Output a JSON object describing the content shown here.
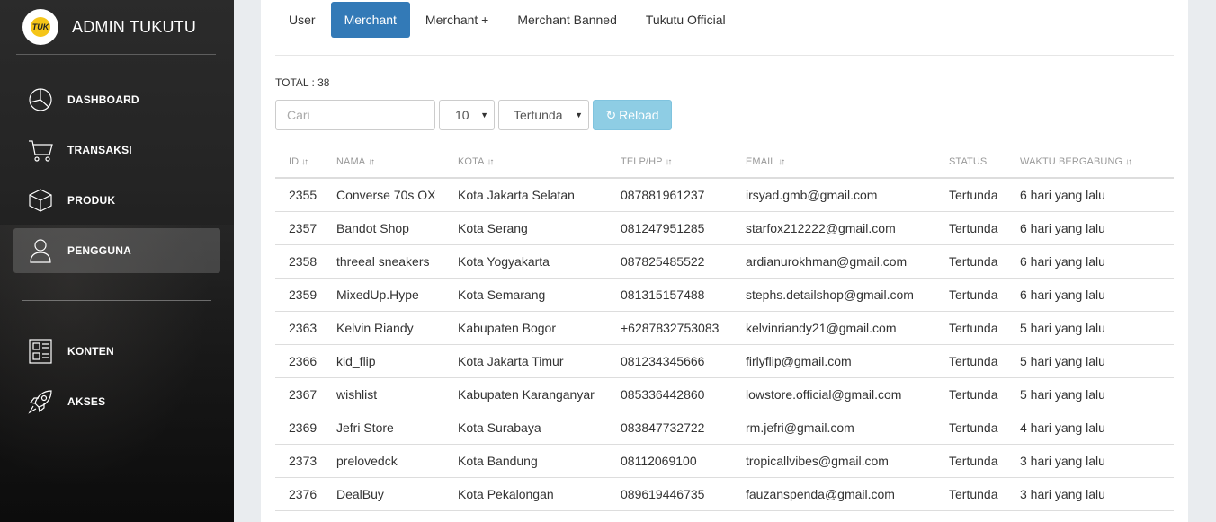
{
  "brand": {
    "logo_text": "TUK",
    "title": "ADMIN TUKUTU"
  },
  "sidebar": {
    "items": [
      {
        "label": "DASHBOARD",
        "icon": "pie-chart-icon"
      },
      {
        "label": "TRANSAKSI",
        "icon": "cart-icon"
      },
      {
        "label": "PRODUK",
        "icon": "box-icon"
      },
      {
        "label": "PENGGUNA",
        "icon": "user-icon",
        "active": true
      },
      {
        "label": "KONTEN",
        "icon": "content-layout-icon"
      },
      {
        "label": "AKSES",
        "icon": "rocket-icon"
      }
    ]
  },
  "tabs": [
    {
      "label": "User"
    },
    {
      "label": "Merchant",
      "active": true
    },
    {
      "label": "Merchant +"
    },
    {
      "label": "Merchant Banned"
    },
    {
      "label": "Tukutu Official"
    }
  ],
  "total_label": "TOTAL : 38",
  "filters": {
    "search_placeholder": "Cari",
    "page_size": "10",
    "status": "Tertunda",
    "reload_label": "Reload"
  },
  "table": {
    "headers": [
      "ID",
      "NAMA",
      "KOTA",
      "TELP/HP",
      "EMAIL",
      "STATUS",
      "WAKTU BERGABUNG"
    ],
    "rows": [
      [
        "2355",
        "Converse 70s OX",
        "Kota Jakarta Selatan",
        "087881961237",
        "irsyad.gmb@gmail.com",
        "Tertunda",
        "6 hari yang lalu"
      ],
      [
        "2357",
        "Bandot Shop",
        "Kota Serang",
        "081247951285",
        "starfox212222@gmail.com",
        "Tertunda",
        "6 hari yang lalu"
      ],
      [
        "2358",
        "threeal sneakers",
        "Kota Yogyakarta",
        "087825485522",
        "ardianurokhman@gmail.com",
        "Tertunda",
        "6 hari yang lalu"
      ],
      [
        "2359",
        "MixedUp.Hype",
        "Kota Semarang",
        "081315157488",
        "stephs.detailshop@gmail.com",
        "Tertunda",
        "6 hari yang lalu"
      ],
      [
        "2363",
        "Kelvin Riandy",
        "Kabupaten Bogor",
        "+6287832753083",
        "kelvinriandy21@gmail.com",
        "Tertunda",
        "5 hari yang lalu"
      ],
      [
        "2366",
        "kid_flip",
        "Kota Jakarta Timur",
        "081234345666",
        "firlyflip@gmail.com",
        "Tertunda",
        "5 hari yang lalu"
      ],
      [
        "2367",
        "wishlist",
        "Kabupaten Karanganyar",
        "085336442860",
        "lowstore.official@gmail.com",
        "Tertunda",
        "5 hari yang lalu"
      ],
      [
        "2369",
        "Jefri Store",
        "Kota Surabaya",
        "083847732722",
        "rm.jefri@gmail.com",
        "Tertunda",
        "4 hari yang lalu"
      ],
      [
        "2373",
        "prelovedck",
        "Kota Bandung",
        "08112069100",
        "tropicallvibes@gmail.com",
        "Tertunda",
        "3 hari yang lalu"
      ],
      [
        "2376",
        "DealBuy",
        "Kota Pekalongan",
        "089619446735",
        "fauzanspenda@gmail.com",
        "Tertunda",
        "3 hari yang lalu"
      ]
    ]
  },
  "colors": {
    "primary": "#337ab7",
    "info": "#8ecde4",
    "sidebar_bg": "#1c1c1c"
  }
}
